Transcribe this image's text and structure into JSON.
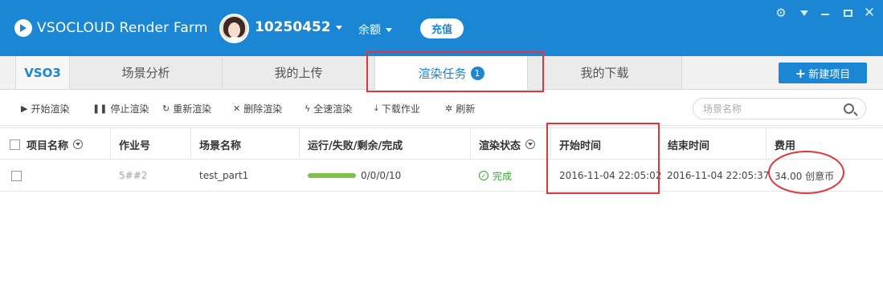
{
  "app": {
    "brand": "VSOCLOUD Render Farm",
    "user_id": "10250452",
    "balance_label": "余额",
    "recharge_label": "充值",
    "accent_color": "#1b86d3"
  },
  "window_controls": {
    "settings_icon": "gear-icon",
    "menu_icon": "triangle-down-icon",
    "minimize_icon": "minimize-icon",
    "maximize_icon": "maximize-icon",
    "close_icon": "close-icon",
    "close_glyph": "✕",
    "gear_glyph": "⚙"
  },
  "tabs": {
    "vso3": "VSO3",
    "scene_analysis": "场景分析",
    "my_uploads": "我的上传",
    "render_tasks": "渲染任务",
    "render_tasks_badge": "1",
    "my_downloads": "我的下载",
    "new_project": "新建项目"
  },
  "toolbar": {
    "start": "开始渲染",
    "stop": "停止渲染",
    "rerender": "重新渲染",
    "delete": "删除渲染",
    "full_speed": "全速渲染",
    "download": "下载作业",
    "refresh": "刷新",
    "search_placeholder": "场景名称"
  },
  "table": {
    "headers": {
      "project_name": "项目名称",
      "job_no": "作业号",
      "scene_name": "场景名称",
      "progress": "运行/失败/剩余/完成",
      "render_status": "渲染状态",
      "start_time": "开始时间",
      "end_time": "结束时间",
      "cost": "费用"
    },
    "rows": [
      {
        "project_name": "",
        "job_no": "5##2",
        "scene_name": "test_part1",
        "progress_fraction": 1.0,
        "counts": "0/0/0/10",
        "render_status": "完成",
        "start_time": "2016-11-04 22:05:02",
        "end_time": "2016-11-04 22:05:37",
        "cost": "34.00 创意币"
      }
    ]
  }
}
